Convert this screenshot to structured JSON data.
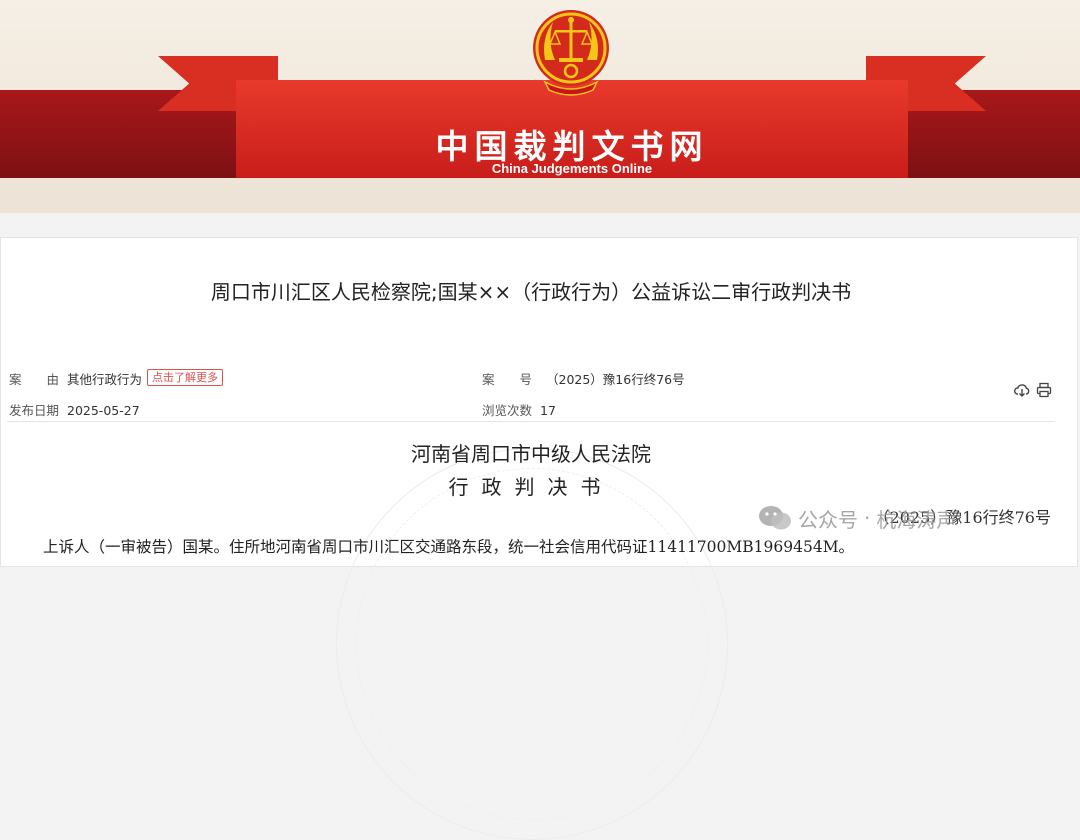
{
  "header": {
    "site_title": "中国裁判文书网",
    "site_subtitle": "China Judgements Online"
  },
  "document": {
    "title": "周口市川汇区人民检察院;国某××（行政行为）公益诉讼二审行政判决书",
    "meta": {
      "cause_label": "案　　由",
      "cause_value": "其他行政行为",
      "cause_link": "点击了解更多",
      "case_label": "案　　号",
      "case_value": "（2025）豫16行终76号",
      "date_label": "发布日期",
      "date_value": "2025-05-27",
      "views_label": "浏览次数",
      "views_value": "17"
    },
    "court": "河南省周口市中级人民法院",
    "doc_type": "行政判决书",
    "case_number": "（2025）豫16行终76号",
    "first_paragraph": "上诉人（一审被告）国某。住所地河南省周口市川汇区交通路东段，统一社会信用代码证11411700MB1969454M。"
  },
  "toolbar": {
    "download_icon": "cloud-download-icon",
    "print_icon": "printer-icon"
  },
  "watermark": {
    "platform": "公众号",
    "separator": "·",
    "account": "杭海涛声"
  },
  "colors": {
    "banner_red": "#c81d1a",
    "banner_dark_red": "#7d1012",
    "tag_red": "#d9534f"
  }
}
